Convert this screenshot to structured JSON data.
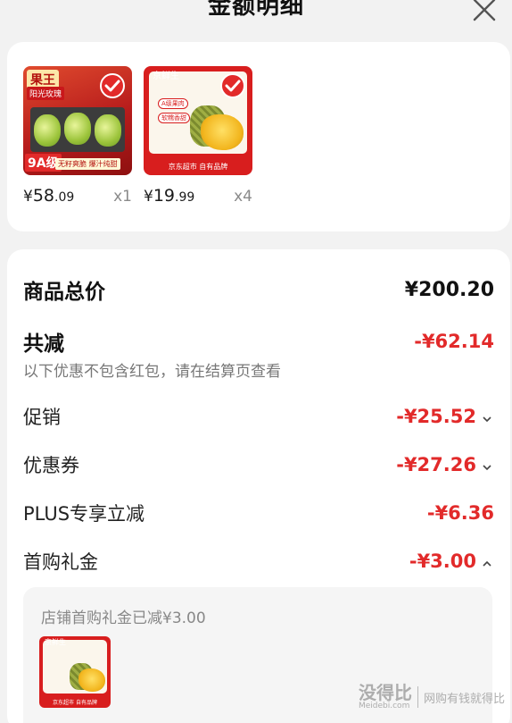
{
  "header": {
    "title": "金额明细",
    "close_icon": "close-icon"
  },
  "products": [
    {
      "image_icon": "grape-product-image",
      "image_text": {
        "brand": "果王",
        "subtitle": "阳光玫瑰",
        "grade": "9A级",
        "slogan": "无籽爽脆 爆汁纯甜"
      },
      "selected": true,
      "price_symbol": "¥",
      "price_int": "58",
      "price_dec": ".09",
      "quantity": "x1"
    },
    {
      "image_icon": "durian-product-image",
      "image_text": {
        "brand": "京鲜生",
        "tag1": "A级果肉",
        "tag2": "软糯香甜",
        "footer": "京东超市 自有品牌"
      },
      "selected": true,
      "price_symbol": "¥",
      "price_int": "19",
      "price_dec": ".99",
      "quantity": "x4"
    }
  ],
  "summary": {
    "total_label": "商品总价",
    "total_value": "¥200.20",
    "discount_label": "共减",
    "discount_value": "-¥62.14",
    "note": "以下优惠不包含红包，请在结算页查看",
    "items": [
      {
        "label": "促销",
        "value": "-¥25.52",
        "chevron": "chevron-down-icon"
      },
      {
        "label": "优惠券",
        "value": "-¥27.26",
        "chevron": "chevron-down-icon"
      },
      {
        "label": "PLUS专享立减",
        "value": "-¥6.36"
      },
      {
        "label": "首购礼金",
        "value": "-¥3.00",
        "chevron": "chevron-up-icon"
      }
    ],
    "detail": {
      "text": "店铺首购礼金已减¥3.00",
      "thumb_brand": "京鲜生",
      "thumb_footer": "京东超市 自有品牌"
    }
  },
  "watermark": {
    "main": "没得比",
    "url": "Meidebi.com",
    "slogan": "网购有钱就得比"
  },
  "colors": {
    "accent_red": "#e22a2a",
    "background": "#f2f2f2",
    "card": "#ffffff"
  }
}
